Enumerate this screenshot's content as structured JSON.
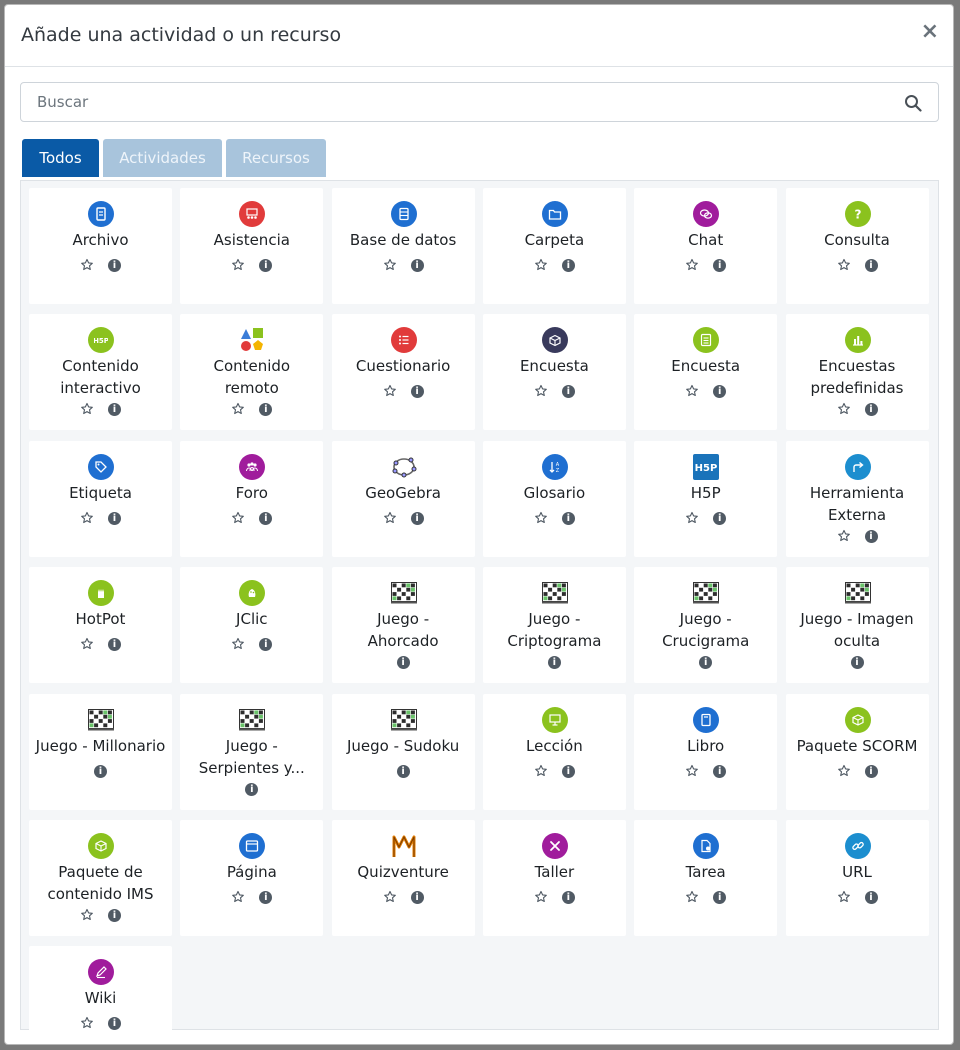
{
  "modal": {
    "title": "Añade una actividad o un recurso",
    "close_label": "×"
  },
  "search": {
    "placeholder": "Buscar"
  },
  "tabs": [
    "Todos",
    "Actividades",
    "Recursos"
  ],
  "activities": [
    {
      "name": "Archivo",
      "lines": [
        "Archivo"
      ],
      "icon": "file-icon",
      "color": "#1f6fd1",
      "star": true
    },
    {
      "name": "Asistencia",
      "lines": [
        "Asistencia"
      ],
      "icon": "attendance-icon",
      "color": "#e13b3b",
      "star": true
    },
    {
      "name": "Base de datos",
      "lines": [
        "Base de datos"
      ],
      "icon": "database-icon",
      "color": "#1f6fd1",
      "star": true
    },
    {
      "name": "Carpeta",
      "lines": [
        "Carpeta"
      ],
      "icon": "folder-icon",
      "color": "#1f6fd1",
      "star": true
    },
    {
      "name": "Chat",
      "lines": [
        "Chat"
      ],
      "icon": "chat-icon",
      "color": "#a01c9c",
      "star": true
    },
    {
      "name": "Consulta",
      "lines": [
        "Consulta"
      ],
      "icon": "question-icon",
      "color": "#8bc21e",
      "star": true
    },
    {
      "name": "Contenido interactivo",
      "lines": [
        "Contenido",
        "interactivo"
      ],
      "icon": "h5p-icon",
      "color": "#8bc21e",
      "star": true
    },
    {
      "name": "Contenido remoto",
      "lines": [
        "Contenido",
        "remoto"
      ],
      "icon": "shapes-icon",
      "color": "#ffffff",
      "star": true
    },
    {
      "name": "Cuestionario",
      "lines": [
        "Cuestionario"
      ],
      "icon": "quiz-icon",
      "color": "#e13b3b",
      "star": true
    },
    {
      "name": "Encuesta",
      "lines": [
        "Encuesta"
      ],
      "icon": "survey-box-icon",
      "color": "#393a5c",
      "star": true
    },
    {
      "name": "Encuesta",
      "lines": [
        "Encuesta"
      ],
      "icon": "feedback-icon",
      "color": "#8bc21e",
      "star": true
    },
    {
      "name": "Encuestas predefinidas",
      "lines": [
        "Encuestas",
        "predefinidas"
      ],
      "icon": "chart-icon",
      "color": "#8bc21e",
      "star": true
    },
    {
      "name": "Etiqueta",
      "lines": [
        "Etiqueta"
      ],
      "icon": "tag-icon",
      "color": "#1f6fd1",
      "star": true
    },
    {
      "name": "Foro",
      "lines": [
        "Foro"
      ],
      "icon": "forum-icon",
      "color": "#a01c9c",
      "star": true
    },
    {
      "name": "GeoGebra",
      "lines": [
        "GeoGebra"
      ],
      "icon": "geogebra-icon",
      "color": "#ffffff",
      "star": true
    },
    {
      "name": "Glosario",
      "lines": [
        "Glosario"
      ],
      "icon": "glossary-icon",
      "color": "#1f6fd1",
      "star": true
    },
    {
      "name": "H5P",
      "lines": [
        "H5P"
      ],
      "icon": "h5p-square-icon",
      "color": "#1a73ba",
      "star": true
    },
    {
      "name": "Herramienta Externa",
      "lines": [
        "Herramienta",
        "Externa"
      ],
      "icon": "external-tool-icon",
      "color": "#1c8ecf",
      "star": true
    },
    {
      "name": "HotPot",
      "lines": [
        "HotPot"
      ],
      "icon": "hotpot-icon",
      "color": "#8bc21e",
      "star": true
    },
    {
      "name": "JClic",
      "lines": [
        "JClic"
      ],
      "icon": "jclic-icon",
      "color": "#8bc21e",
      "star": true
    },
    {
      "name": "Juego - Ahorcado",
      "lines": [
        "Juego -",
        "Ahorcado"
      ],
      "icon": "game-grid-icon",
      "color": "#ffffff",
      "star": false
    },
    {
      "name": "Juego - Criptograma",
      "lines": [
        "Juego -",
        "Criptograma"
      ],
      "icon": "game-grid-icon",
      "color": "#ffffff",
      "star": false
    },
    {
      "name": "Juego - Crucigrama",
      "lines": [
        "Juego -",
        "Crucigrama"
      ],
      "icon": "game-grid-icon",
      "color": "#ffffff",
      "star": false
    },
    {
      "name": "Juego - Imagen oculta",
      "lines": [
        "Juego - Imagen",
        "oculta"
      ],
      "icon": "game-grid-icon",
      "color": "#ffffff",
      "star": false
    },
    {
      "name": "Juego - Millonario",
      "lines": [
        "Juego - Millonario"
      ],
      "icon": "game-grid-icon",
      "color": "#ffffff",
      "star": false
    },
    {
      "name": "Juego - Serpientes y...",
      "lines": [
        "Juego -",
        "Serpientes y..."
      ],
      "icon": "game-grid-icon",
      "color": "#ffffff",
      "star": false
    },
    {
      "name": "Juego - Sudoku",
      "lines": [
        "Juego - Sudoku"
      ],
      "icon": "game-grid-icon",
      "color": "#ffffff",
      "star": false
    },
    {
      "name": "Lección",
      "lines": [
        "Lección"
      ],
      "icon": "lesson-icon",
      "color": "#8bc21e",
      "star": true
    },
    {
      "name": "Libro",
      "lines": [
        "Libro"
      ],
      "icon": "book-icon",
      "color": "#1f6fd1",
      "star": true
    },
    {
      "name": "Paquete SCORM",
      "lines": [
        "Paquete SCORM"
      ],
      "icon": "scorm-icon",
      "color": "#8bc21e",
      "star": true
    },
    {
      "name": "Paquete de contenido IMS",
      "lines": [
        "Paquete de",
        "contenido IMS"
      ],
      "icon": "ims-package-icon",
      "color": "#8bc21e",
      "star": true
    },
    {
      "name": "Página",
      "lines": [
        "Página"
      ],
      "icon": "page-icon",
      "color": "#1f6fd1",
      "star": true
    },
    {
      "name": "Quizventure",
      "lines": [
        "Quizventure"
      ],
      "icon": "quizventure-icon",
      "color": "#ffffff",
      "star": true
    },
    {
      "name": "Taller",
      "lines": [
        "Taller"
      ],
      "icon": "workshop-icon",
      "color": "#a01c9c",
      "star": true
    },
    {
      "name": "Tarea",
      "lines": [
        "Tarea"
      ],
      "icon": "assignment-icon",
      "color": "#1f6fd1",
      "star": true
    },
    {
      "name": "URL",
      "lines": [
        "URL"
      ],
      "icon": "link-icon",
      "color": "#1c8ecf",
      "star": true
    },
    {
      "name": "Wiki",
      "lines": [
        "Wiki"
      ],
      "icon": "wiki-icon",
      "color": "#a01c9c",
      "star": true
    }
  ]
}
